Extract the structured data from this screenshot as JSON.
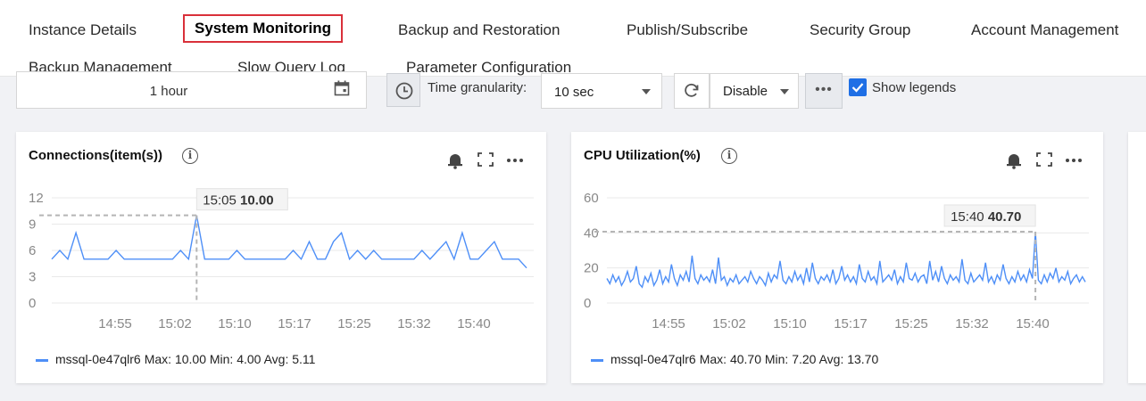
{
  "tabs": [
    {
      "label": "Instance Details",
      "active": false
    },
    {
      "label": "System Monitoring",
      "active": true
    },
    {
      "label": "Backup and Restoration",
      "active": false
    },
    {
      "label": "Publish/Subscribe",
      "active": false
    },
    {
      "label": "Security Group",
      "active": false
    },
    {
      "label": "Account Management",
      "active": false
    },
    {
      "label": "Backup Management",
      "active": false
    },
    {
      "label": "Slow Query Log",
      "active": false
    },
    {
      "label": "Parameter Configuration",
      "active": false
    }
  ],
  "toolbar": {
    "time_range": "1 hour",
    "granularity_label": "Time granularity:",
    "granularity_value": "10 sec",
    "refresh_value": "Disable",
    "more_label": "•••",
    "show_legends_label": "Show legends",
    "show_legends_checked": true
  },
  "colors": {
    "accent": "#1f6fe5",
    "series": "#4e8ff7",
    "active_tab_border": "#d9303a"
  },
  "cards": [
    {
      "title": "Connections(item(s))",
      "tooltip_time": "15:05",
      "tooltip_value": "10.00",
      "legend_name": "mssql-0e47qlr6",
      "legend_stats": "Max: 10.00  Min: 4.00  Avg: 5.11"
    },
    {
      "title": "CPU Utilization(%)",
      "tooltip_time": "15:40",
      "tooltip_value": "40.70",
      "legend_name": "mssql-0e47qlr6",
      "legend_stats": "Max: 40.70  Min: 7.20  Avg: 13.70"
    }
  ],
  "chart_data": [
    {
      "type": "line",
      "title": "Connections(item(s))",
      "ylim": [
        0,
        12
      ],
      "yticks": [
        0,
        3,
        6,
        9,
        12
      ],
      "xticks": [
        "14:55",
        "15:02",
        "15:10",
        "15:17",
        "15:25",
        "15:32",
        "15:40"
      ],
      "xlim_minutes": [
        14.8,
        15.83
      ],
      "marker": {
        "time": "15:05",
        "value": 10.0
      },
      "series": [
        {
          "name": "mssql-0e47qlr6",
          "x": [
            "14:50",
            "14:51",
            "14:52",
            "14:52",
            "14:53",
            "14:53",
            "14:54",
            "14:55",
            "14:56",
            "14:57",
            "14:58",
            "14:59",
            "15:00",
            "15:01",
            "15:02",
            "15:03",
            "15:04",
            "15:05",
            "15:05",
            "15:06",
            "15:07",
            "15:08",
            "15:09",
            "15:10",
            "15:11",
            "15:12",
            "15:13",
            "15:14",
            "15:15",
            "15:16",
            "15:17",
            "15:18",
            "15:19",
            "15:20",
            "15:21",
            "15:22",
            "15:23",
            "15:24",
            "15:25",
            "15:26",
            "15:27",
            "15:28",
            "15:29",
            "15:30",
            "15:31",
            "15:32",
            "15:33",
            "15:34",
            "15:35",
            "15:36",
            "15:37",
            "15:38",
            "15:39",
            "15:40",
            "15:41",
            "15:42",
            "15:43",
            "15:44",
            "15:45",
            "15:46"
          ],
          "y": [
            5,
            6,
            5,
            8,
            5,
            5,
            5,
            5,
            6,
            5,
            5,
            5,
            5,
            5,
            5,
            5,
            6,
            5,
            10,
            5,
            5,
            5,
            5,
            6,
            5,
            5,
            5,
            5,
            5,
            5,
            6,
            5,
            7,
            5,
            5,
            7,
            8,
            5,
            6,
            5,
            6,
            5,
            5,
            5,
            5,
            5,
            6,
            5,
            6,
            7,
            5,
            8,
            5,
            5,
            6,
            7,
            5,
            5,
            5,
            4
          ],
          "x_minutes": [
            50.0,
            50.7,
            51.4,
            52.0,
            52.5,
            53.2,
            53.9,
            54.6,
            55.4,
            56.2,
            56.9,
            57.6,
            58.3,
            59.0,
            59.7,
            60.4,
            61.6,
            62.4,
            62.8,
            63.2,
            63.9,
            64.6,
            65.3,
            66.4,
            67.0,
            67.7,
            68.4,
            69.1,
            69.8,
            70.6,
            71.4,
            72.2,
            73.4,
            74.4,
            75.4,
            76.8,
            77.4,
            78.0,
            78.8,
            79.6,
            80.1,
            81.0,
            82.0,
            82.8,
            83.6,
            84.6,
            85.0,
            85.8,
            86.6,
            87.4,
            88.2,
            89.0,
            89.8,
            90.6,
            91.4,
            92.2,
            93.0,
            94.0,
            95.0,
            96.0
          ]
        }
      ]
    },
    {
      "type": "line",
      "title": "CPU Utilization(%)",
      "ylim": [
        0,
        60
      ],
      "yticks": [
        0,
        20,
        40,
        60
      ],
      "xticks": [
        "14:55",
        "15:02",
        "15:10",
        "15:17",
        "15:25",
        "15:32",
        "15:40"
      ],
      "marker": {
        "time": "15:40",
        "value": 40.7
      },
      "series": [
        {
          "name": "mssql-0e47qlr6",
          "y": [
            14,
            11,
            16,
            12,
            15,
            10,
            13,
            18,
            12,
            14,
            21,
            11,
            9,
            15,
            12,
            17,
            10,
            13,
            19,
            11,
            15,
            12,
            22,
            14,
            10,
            16,
            13,
            18,
            12,
            27,
            14,
            11,
            16,
            13,
            15,
            12,
            19,
            11,
            26,
            13,
            15,
            10,
            14,
            12,
            16,
            11,
            13,
            15,
            12,
            18,
            14,
            11,
            15,
            13,
            10,
            17,
            12,
            16,
            14,
            24,
            13,
            11,
            15,
            12,
            18,
            13,
            16,
            11,
            20,
            12,
            23,
            14,
            11,
            15,
            13,
            16,
            12,
            19,
            11,
            14,
            21,
            13,
            16,
            12,
            15,
            11,
            22,
            14,
            12,
            18,
            13,
            15,
            11,
            24,
            12,
            14,
            16,
            13,
            19,
            11,
            15,
            12,
            23,
            14,
            13,
            17,
            12,
            15,
            16,
            11,
            24,
            13,
            18,
            12,
            21,
            14,
            11,
            16,
            13,
            15,
            12,
            25,
            13,
            11,
            17,
            12,
            14,
            16,
            13,
            23,
            12,
            15,
            11,
            16,
            13,
            22,
            14,
            11,
            15,
            12,
            18,
            13,
            16,
            12,
            19,
            14,
            40.7,
            13,
            11,
            16,
            12,
            17,
            14,
            20,
            12,
            15,
            13,
            18,
            11,
            14,
            16,
            12,
            15,
            12
          ]
        }
      ]
    }
  ]
}
